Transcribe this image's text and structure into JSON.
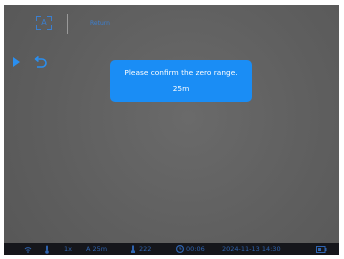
{
  "topbar": {
    "mode_icon_text": "A",
    "label": "Return"
  },
  "dialog": {
    "message": "Please confirm the zero range.",
    "value": "25m"
  },
  "status": {
    "zoom": "1x",
    "range": "A 25m",
    "zero_value": "222",
    "timer": "00:06",
    "datetime": "2024-11-13  14:30"
  },
  "colors": {
    "accent": "#1a8df5",
    "background": "#626262",
    "statusbar": "#15161b"
  }
}
